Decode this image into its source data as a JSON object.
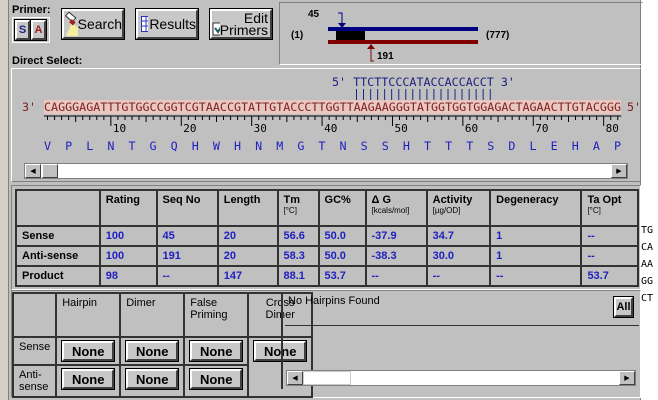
{
  "toolbar": {
    "primer_label": "Primer:",
    "sense_btn": "S",
    "antisense_btn": "A",
    "search": "Search",
    "results": "Results",
    "edit_primers_1": "Edit",
    "edit_primers_2": "Primers",
    "direct_select": "Direct Select:"
  },
  "map": {
    "sense_pos": "45",
    "antisense_pos": "191",
    "start": "(1)",
    "end": "(777)",
    "sense_color": "#000080",
    "antisense_color": "#800000"
  },
  "sequence": {
    "primer": "5' TTCTTCCCATACCACCACCT 3'",
    "bars": "||||||||||||||||||||",
    "template_prefix": "3'",
    "template": "CAGGGAGATTTGTGGCCGGTCGTAACCGTATTGTACCCTTGGTTAAGAAGGGTATGGTGGTGGAGACTAGAACTTGTACGGG",
    "template_suffix": "5'",
    "ruler": [
      "10",
      "20",
      "30",
      "40",
      "50",
      "60",
      "70",
      "80"
    ],
    "amino_acids": "V  P  L  N  T  G  Q  H  W  H  N  M  G  T  N  S  S  H  T  T  T  S  D  L  E  H  A  P"
  },
  "results": {
    "headers": [
      {
        "t": "",
        "u": ""
      },
      {
        "t": "Rating",
        "u": ""
      },
      {
        "t": "Seq No",
        "u": ""
      },
      {
        "t": "Length",
        "u": ""
      },
      {
        "t": "Tm",
        "u": "[°C]"
      },
      {
        "t": "GC%",
        "u": ""
      },
      {
        "t": "Δ G",
        "u": "[kcals/mol]"
      },
      {
        "t": "Activity",
        "u": "[µg/OD]"
      },
      {
        "t": "Degeneracy",
        "u": ""
      },
      {
        "t": "Ta Opt",
        "u": "[°C]"
      }
    ],
    "rows": [
      {
        "name": "Sense",
        "values": [
          "100",
          "45",
          "20",
          "56.6",
          "50.0",
          "-37.9",
          "34.7",
          "1",
          "--"
        ]
      },
      {
        "name": "Anti-sense",
        "values": [
          "100",
          "191",
          "20",
          "58.3",
          "50.0",
          "-38.3",
          "30.0",
          "1",
          "--"
        ]
      },
      {
        "name": "Product",
        "values": [
          "98",
          "--",
          "147",
          "88.1",
          "53.7",
          "--",
          "--",
          "--",
          "53.7"
        ]
      }
    ]
  },
  "analysis": {
    "headers": [
      "Hairpin",
      "Dimer",
      "False Priming",
      "Cross Dimer"
    ],
    "sense_label": "Sense",
    "antisense_label": "Anti-sense",
    "none": "None",
    "message": "No Hairpins Found",
    "all_btn": "All"
  },
  "background_window": {
    "fragments": [
      "TG",
      "CA",
      "AA",
      "GG",
      "CT"
    ]
  }
}
